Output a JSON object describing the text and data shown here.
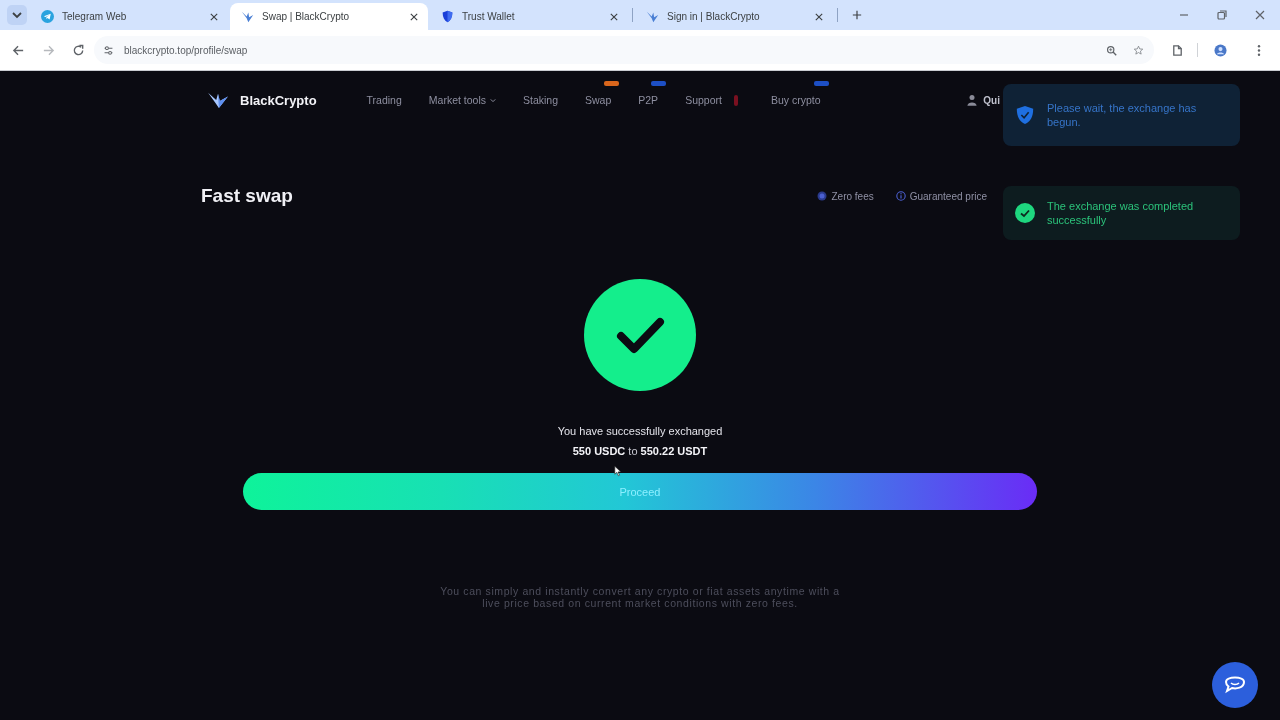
{
  "browser": {
    "tabs": [
      {
        "title": "Telegram Web",
        "kind": "plane",
        "selected": false
      },
      {
        "title": "Swap | BlackCrypto",
        "kind": "bird",
        "selected": true
      },
      {
        "title": "Trust Wallet",
        "kind": "shield",
        "selected": false
      },
      {
        "title": "Sign in | BlackCrypto",
        "kind": "bird",
        "selected": false
      }
    ],
    "url": "blackcrypto.top/profile/swap"
  },
  "header": {
    "brand": "BlackCrypto",
    "nav": [
      {
        "label": "Trading",
        "dropdown": false
      },
      {
        "label": "Market tools",
        "dropdown": true
      },
      {
        "label": "Staking",
        "dropdown": false
      },
      {
        "label": "Swap",
        "dropdown": false,
        "badge": {
          "color": "#d9661c",
          "kind": "pill"
        }
      },
      {
        "label": "P2P",
        "dropdown": false,
        "badge": {
          "color": "#1d4fc4",
          "kind": "pill"
        }
      },
      {
        "label": "Support",
        "dropdown": false,
        "badge": {
          "color": "#7a1020",
          "kind": "bar"
        }
      },
      {
        "label": "Buy crypto",
        "dropdown": false,
        "badge": {
          "color": "#1d4fc4",
          "kind": "pill"
        }
      }
    ],
    "account": "Qui"
  },
  "swap": {
    "title": "Fast swap",
    "features": [
      {
        "label": "Zero fees",
        "kind": "dot"
      },
      {
        "label": "Guaranteed price",
        "kind": "info"
      }
    ],
    "message": "You have successfully exchanged",
    "amount": "**550 USDC** to **550.22 USDT**",
    "button": "Proceed",
    "note": "You can simply and instantly convert any crypto or fiat assets anytime with a live price based on current market conditions with zero fees."
  },
  "toasts": [
    {
      "kind": "info",
      "text": "Please wait, the exchange has begun."
    },
    {
      "kind": "success",
      "text": "The exchange was completed successfully"
    }
  ]
}
